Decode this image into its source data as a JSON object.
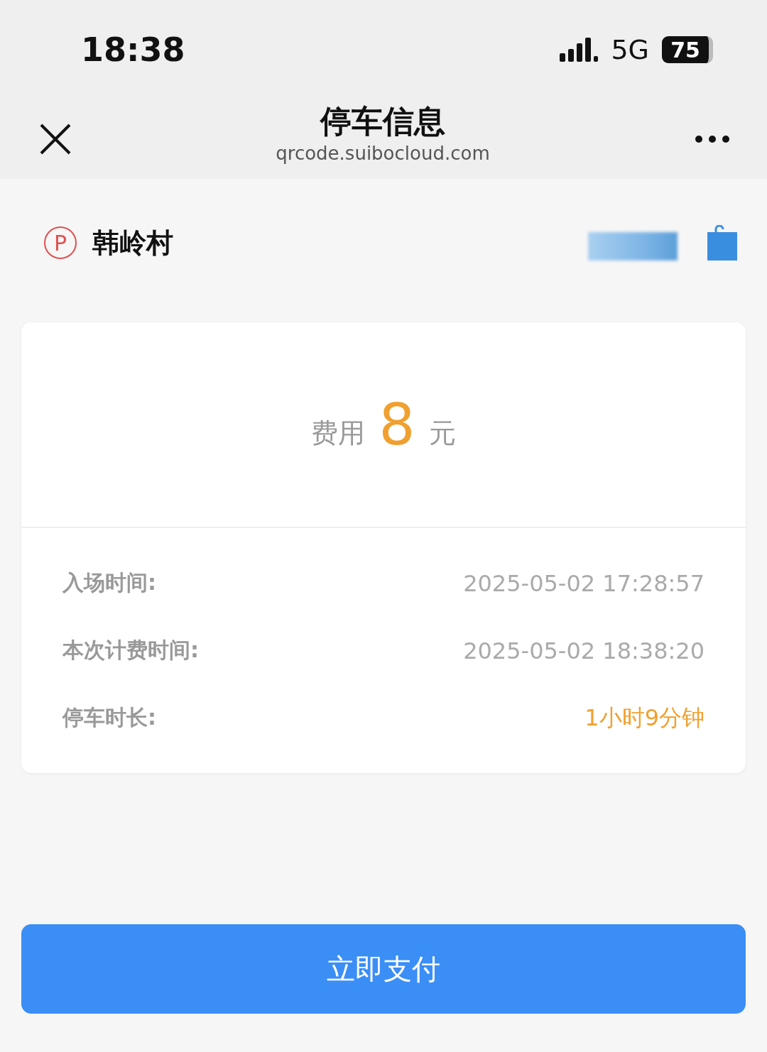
{
  "status_bar": {
    "time": "18:38",
    "network": "5G",
    "battery": "75"
  },
  "nav_bar": {
    "title": "停车信息",
    "subtitle": "qrcode.suibocloud.com"
  },
  "lot": {
    "name": "韩岭村",
    "badge": "P"
  },
  "fee": {
    "label": "费用",
    "amount": "8",
    "unit": "元"
  },
  "details": [
    {
      "label": "入场时间:",
      "value": "2025-05-02 17:28:57",
      "highlight": false
    },
    {
      "label": "本次计费时间:",
      "value": "2025-05-02 18:38:20",
      "highlight": false
    },
    {
      "label": "停车时长:",
      "value": "1小时9分钟",
      "highlight": true
    }
  ],
  "pay_button": {
    "label": "立即支付"
  }
}
